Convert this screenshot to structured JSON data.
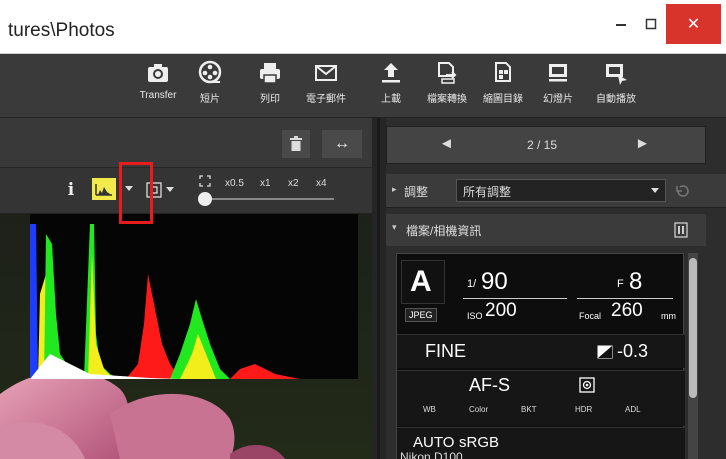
{
  "window": {
    "title": "tures\\Photos",
    "close_symbol": "✕"
  },
  "toolbar": {
    "items": [
      {
        "label": "Transfer",
        "icon": "camera-transfer-icon"
      },
      {
        "label": "短片",
        "icon": "film-reel-icon"
      },
      {
        "label": "列印",
        "icon": "printer-icon"
      },
      {
        "label": "電子郵件",
        "icon": "envelope-icon"
      },
      {
        "label": "上載",
        "icon": "upload-icon"
      },
      {
        "label": "檔案轉換",
        "icon": "file-convert-icon"
      },
      {
        "label": "縮圖目錄",
        "icon": "contact-sheet-icon"
      },
      {
        "label": "幻燈片",
        "icon": "slideshow-icon"
      },
      {
        "label": "自動播放",
        "icon": "autoplay-icon"
      }
    ]
  },
  "viewer": {
    "info_button": "i",
    "swap_symbol": "↔",
    "zoom_levels": [
      "x0.5",
      "x1",
      "x2",
      "x4"
    ],
    "histogram": {
      "colors": {
        "red": "#ff1a1a",
        "green": "#21e81f",
        "yellow": "#f2ee1c",
        "blue": "#1e3cff",
        "white": "#ffffff"
      }
    }
  },
  "nav": {
    "prev_symbol": "◄",
    "next_symbol": "►",
    "page": "2 / 15"
  },
  "adjust": {
    "label": "調整",
    "selected": "所有調整"
  },
  "file_info": {
    "title": "檔案/相機資訊"
  },
  "camera": {
    "mode": "A",
    "shutter_prefix": "1/",
    "shutter": "90",
    "aperture_prefix": "F",
    "aperture": "8",
    "format": "JPEG",
    "iso_label": "ISO",
    "iso": "200",
    "focal_label": "Focal",
    "focal": "260",
    "focal_unit": "mm",
    "quality": "FINE",
    "exposure_comp": "-0.3",
    "focus_mode": "AF-S",
    "sub_labels": [
      "WB",
      "Color",
      "BKT",
      "HDR",
      "ADL"
    ],
    "wb": "AUTO",
    "color_space": "sRGB",
    "model_partial": "Nikon D100"
  }
}
